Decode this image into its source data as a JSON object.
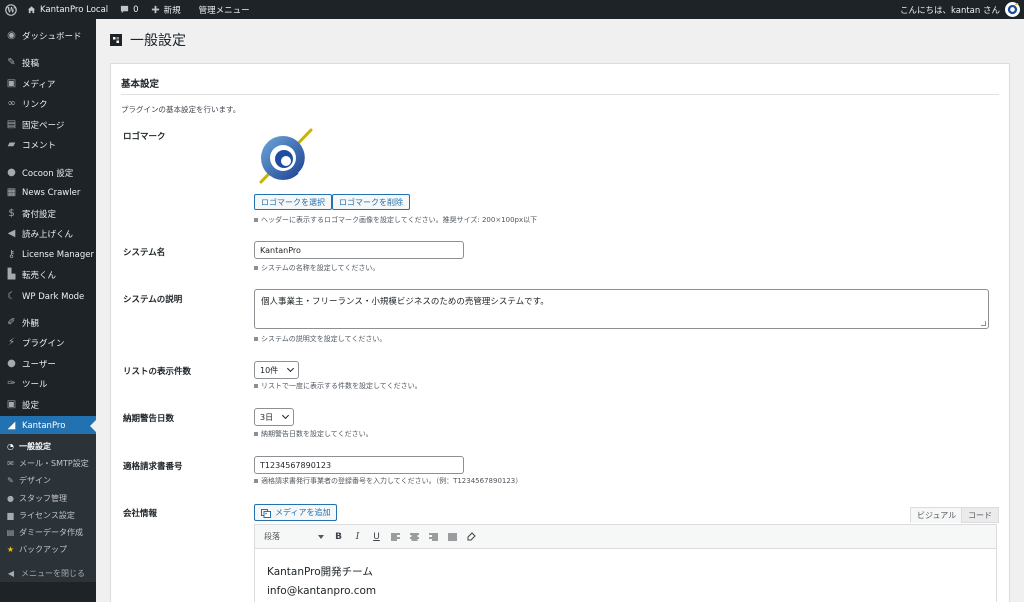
{
  "adminbar": {
    "site_name": "KantanPro Local",
    "comments_count": "0",
    "new_label": "新規",
    "admin_menu_label": "管理メニュー",
    "greeting": "こんにちは、kantan さん"
  },
  "sidebar": {
    "items": [
      {
        "label": "ダッシュボード",
        "icon": "dashboard-icon"
      },
      {
        "label": "投稿",
        "icon": "pin-icon"
      },
      {
        "label": "メディア",
        "icon": "media-icon"
      },
      {
        "label": "リンク",
        "icon": "link-icon"
      },
      {
        "label": "固定ページ",
        "icon": "page-icon"
      },
      {
        "label": "コメント",
        "icon": "comment-icon"
      },
      {
        "label": "Cocoon 設定",
        "icon": "cocoon-icon"
      },
      {
        "label": "News Crawler",
        "icon": "news-icon"
      },
      {
        "label": "寄付設定",
        "icon": "dollar-icon"
      },
      {
        "label": "読み上げくん",
        "icon": "megaphone-icon"
      },
      {
        "label": "License Manager",
        "icon": "key-icon"
      },
      {
        "label": "転売くん",
        "icon": "cart-icon"
      },
      {
        "label": "WP Dark Mode",
        "icon": "moon-icon"
      },
      {
        "label": "外観",
        "icon": "brush-icon"
      },
      {
        "label": "プラグイン",
        "icon": "plugin-icon"
      },
      {
        "label": "ユーザー",
        "icon": "user-icon"
      },
      {
        "label": "ツール",
        "icon": "wrench-icon"
      },
      {
        "label": "設定",
        "icon": "settings-icon"
      },
      {
        "label": "KantanPro",
        "icon": "chart-icon"
      }
    ],
    "submenu": [
      {
        "label": "一般設定",
        "icon": "clock-icon"
      },
      {
        "label": "メール・SMTP設定",
        "icon": "mail-icon"
      },
      {
        "label": "デザイン",
        "icon": "pen-icon"
      },
      {
        "label": "スタッフ管理",
        "icon": "person-icon"
      },
      {
        "label": "ライセンス設定",
        "icon": "lock-icon"
      },
      {
        "label": "ダミーデータ作成",
        "icon": "db-icon"
      },
      {
        "label": "バックアップ",
        "icon": "star-icon"
      }
    ],
    "collapse_label": "メニューを閉じる"
  },
  "page": {
    "title": "一般設定"
  },
  "section": {
    "heading": "基本設定",
    "description": "プラグインの基本設定を行います。"
  },
  "fields": {
    "logo": {
      "label": "ロゴマーク",
      "select_button": "ロゴマークを選択",
      "delete_button": "ロゴマークを削除",
      "help": "ヘッダーに表示するロゴマーク画像を設定してください。推奨サイズ: 200×100px以下"
    },
    "system_name": {
      "label": "システム名",
      "value": "KantanPro",
      "help": "システムの名称を設定してください。"
    },
    "system_desc": {
      "label": "システムの説明",
      "value": "個人事業主・フリーランス・小規模ビジネスのための売管理システムです。",
      "help": "システムの説明文を設定してください。"
    },
    "list_count": {
      "label": "リストの表示件数",
      "value": "10件",
      "help": "リストで一度に表示する件数を設定してください。"
    },
    "warning_days": {
      "label": "納期警告日数",
      "value": "3日",
      "help": "納期警告日数を設定してください。"
    },
    "invoice_no": {
      "label": "適格請求書番号",
      "value": "T1234567890123",
      "help": "適格請求書発行事業者の登録番号を入力してください。（例：T1234567890123）"
    },
    "company": {
      "label": "会社情報",
      "media_button": "メディアを追加",
      "tab_visual": "ビジュアル",
      "tab_code": "コード",
      "format_select": "段落",
      "lines": [
        "KantanPro開発チーム",
        "info@kantanpro.com"
      ]
    }
  },
  "colors": {
    "accent": "#2271b1",
    "admin_dark": "#1d2327"
  }
}
